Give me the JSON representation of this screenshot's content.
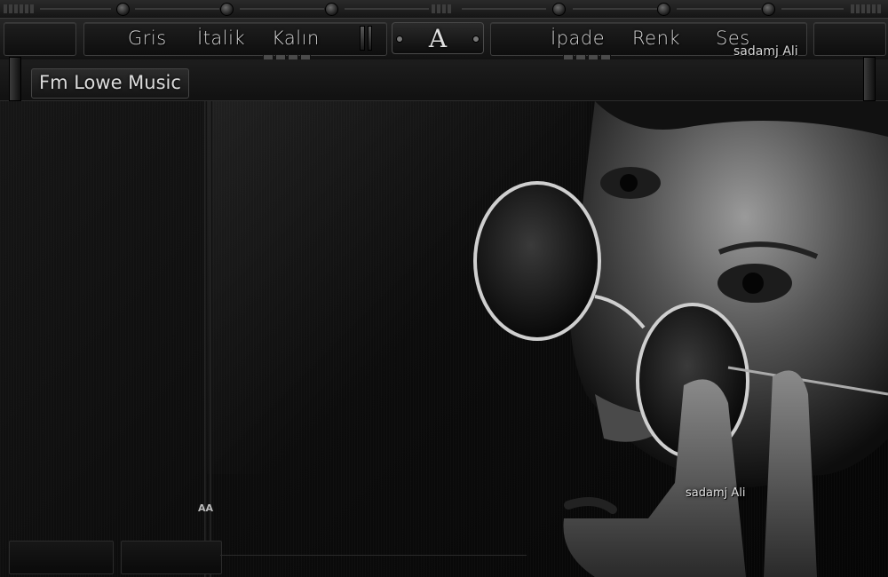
{
  "nav": {
    "items_left": [
      {
        "label": "Gris"
      },
      {
        "label": "İtalik"
      },
      {
        "label": "Kalın"
      }
    ],
    "logo_glyph": "A",
    "items_right": [
      {
        "label": "İpade"
      },
      {
        "label": "Renk"
      },
      {
        "label": "Ses"
      }
    ]
  },
  "signature_top": "sadamj Ali",
  "site_title": "Fm Lowe Music",
  "rail_marker": "AA",
  "signature_image": "sadamj Ali",
  "colors": {
    "background": "#0b0b0b",
    "bar": "#1a1a1a",
    "text": "#d2d2d2"
  },
  "icons": [
    "logo-emblem-icon",
    "rail-knob-icon"
  ]
}
